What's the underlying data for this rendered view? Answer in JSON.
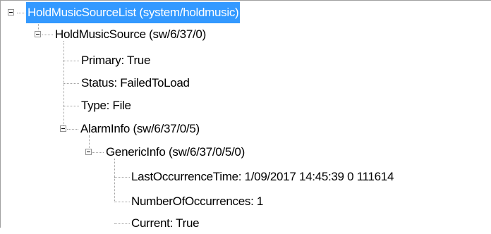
{
  "tree": {
    "root": {
      "label": "HoldMusicSourceList (system/holdmusic)"
    },
    "hold_music_source": {
      "label": "HoldMusicSource (sw/6/37/0)"
    },
    "primary": {
      "label": "Primary: True"
    },
    "status": {
      "label": "Status: FailedToLoad"
    },
    "type": {
      "label": "Type: File"
    },
    "alarm_info": {
      "label": "AlarmInfo (sw/6/37/0/5)"
    },
    "generic_info": {
      "label": "GenericInfo (sw/6/37/0/5/0)"
    },
    "last_occurrence_time": {
      "label": "LastOccurrenceTime: 1/09/2017 14:45:39 0 111614"
    },
    "number_of_occurrences": {
      "label": "NumberOfOccurrences: 1"
    },
    "current": {
      "label": "Current: True"
    }
  },
  "colors": {
    "selection": "#3399ff",
    "selection_text": "#ffffff",
    "lines": "#a0a0a0"
  },
  "icons": {
    "expanded": "minus-box-icon"
  }
}
